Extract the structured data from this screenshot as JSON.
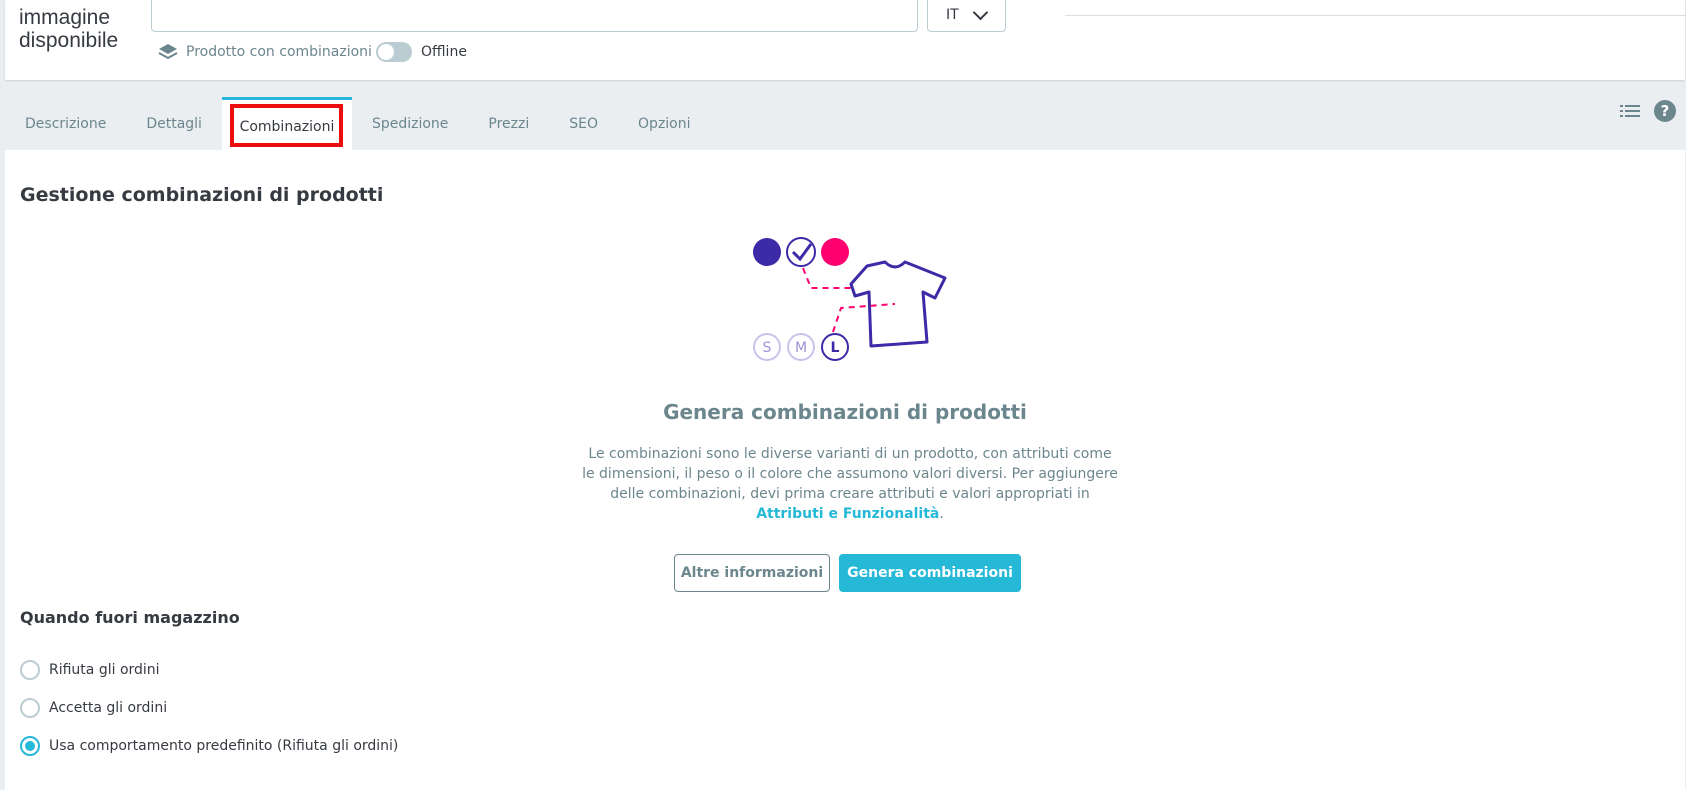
{
  "header": {
    "no_image_text": "immagine disponibile",
    "lang_value": "IT",
    "product_type": "Prodotto con combinazioni",
    "status_label": "Offline"
  },
  "tabs": [
    {
      "label": "Descrizione"
    },
    {
      "label": "Dettagli"
    },
    {
      "label": "Combinazioni",
      "active": true
    },
    {
      "label": "Spedizione"
    },
    {
      "label": "Prezzi"
    },
    {
      "label": "SEO"
    },
    {
      "label": "Opzioni"
    }
  ],
  "main": {
    "section_title": "Gestione combinazioni di prodotti",
    "sizes": [
      "S",
      "M",
      "L"
    ],
    "empty_title": "Genera combinazioni di prodotti",
    "empty_desc": "Le combinazioni sono le diverse varianti di un prodotto, con attributi come le dimensioni, il peso o il colore che assumono valori diversi. Per aggiungere delle combinazioni, devi prima creare attributi e valori appropriati in",
    "empty_link": "Attributi e Funzionalità",
    "empty_desc_end": ".",
    "btn_more": "Altre informazioni",
    "btn_generate": "Genera combinazioni",
    "stock_title": "Quando fuori magazzino",
    "stock_options": [
      {
        "label": "Rifiuta gli ordini",
        "checked": false
      },
      {
        "label": "Accetta gli ordini",
        "checked": false
      },
      {
        "label": "Usa comportamento predefinito (Rifiuta gli ordini)",
        "checked": true
      }
    ]
  },
  "colors": {
    "accent": "#25b9d7",
    "highlight": "#ec0d0d",
    "swatch_purple": "#3d2aa6",
    "swatch_pink": "#ff0070"
  }
}
